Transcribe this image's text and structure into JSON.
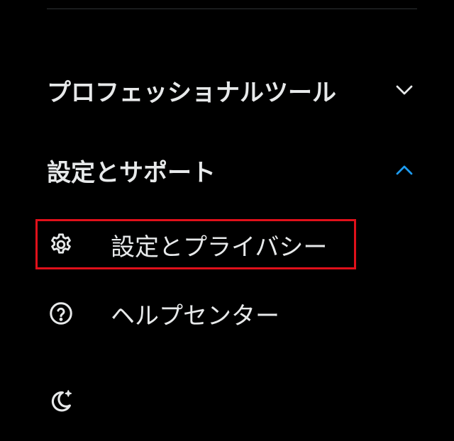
{
  "colors": {
    "background": "#000000",
    "text": "#e7e9ea",
    "accent": "#1d9bf0",
    "highlight": "#e0101a",
    "divider": "#2f3336"
  },
  "sections": {
    "professional_tools": {
      "label": "プロフェッショナルツール",
      "expanded": false,
      "icon": "chevron-down-icon"
    },
    "settings_support": {
      "label": "設定とサポート",
      "expanded": true,
      "icon": "chevron-up-icon"
    }
  },
  "menu": {
    "settings_privacy": {
      "label": "設定とプライバシー",
      "icon": "gear-icon",
      "highlighted": true
    },
    "help_center": {
      "label": "ヘルプセンター",
      "icon": "help-circle-icon"
    },
    "display": {
      "icon": "moon-sparkle-icon"
    }
  }
}
